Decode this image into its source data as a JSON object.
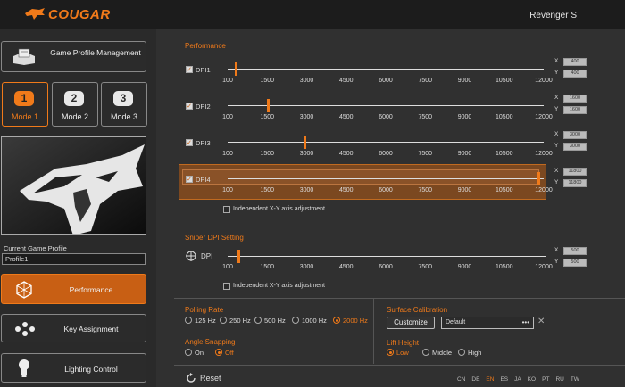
{
  "brand": "COUGAR",
  "device_name": "Revenger S",
  "sidebar": {
    "game_profile_label": "Game Profile Management",
    "modes": [
      {
        "num": "1",
        "label": "Mode 1",
        "selected": true
      },
      {
        "num": "2",
        "label": "Mode 2",
        "selected": false
      },
      {
        "num": "3",
        "label": "Mode 3",
        "selected": false
      }
    ],
    "current_profile_label": "Current Game Profile",
    "current_profile_value": "Profile1",
    "nav": [
      {
        "label": "Performance",
        "icon": "hexagon-icon",
        "selected": true
      },
      {
        "label": "Key Assignment",
        "icon": "mouse-buttons-icon",
        "selected": false
      },
      {
        "label": "Lighting Control",
        "icon": "lightbulb-icon",
        "selected": false
      }
    ]
  },
  "performance": {
    "title": "Performance",
    "ticks": [
      "100",
      "1500",
      "3000",
      "4500",
      "6000",
      "7500",
      "9000",
      "10500",
      "12000"
    ],
    "dpi_levels": [
      {
        "label": "DPI1",
        "checked": true,
        "value": 400,
        "x": "400",
        "y": "400",
        "selected": false
      },
      {
        "label": "DPI2",
        "checked": true,
        "value": 1600,
        "x": "1600",
        "y": "1600",
        "selected": false
      },
      {
        "label": "DPI3",
        "checked": true,
        "value": 3000,
        "x": "3000",
        "y": "3000",
        "selected": false
      },
      {
        "label": "DPI4",
        "checked": true,
        "value": 11800,
        "x": "11800",
        "y": "11800",
        "selected": true
      }
    ],
    "independent_label": "Independent X-Y axis adjustment",
    "x_label": "X",
    "y_label": "Y"
  },
  "sniper": {
    "title": "Sniper DPI Setting",
    "label": "DPI",
    "value": 500,
    "x": "500",
    "y": "500",
    "independent_label": "Independent X-Y axis adjustment"
  },
  "polling": {
    "title": "Polling Rate",
    "options": [
      "125 Hz",
      "250 Hz",
      "500 Hz",
      "1000 Hz",
      "2000 Hz"
    ],
    "selected": "2000 Hz"
  },
  "angle_snapping": {
    "title": "Angle Snapping",
    "options": [
      "On",
      "Off"
    ],
    "selected": "Off"
  },
  "surface": {
    "title": "Surface Calibration",
    "customize_label": "Customize",
    "value": "Default",
    "dots": "•••"
  },
  "lift_height": {
    "title": "Lift Height",
    "options": [
      "Low",
      "Middle",
      "High"
    ],
    "selected": "Low"
  },
  "reset_label": "Reset",
  "languages": [
    "CN",
    "DE",
    "EN",
    "ES",
    "JA",
    "KO",
    "PT",
    "RU",
    "TW"
  ],
  "current_language": "EN",
  "colors": {
    "accent": "#f07a1a",
    "panel": "#303030",
    "sidebar": "#2a2a2a"
  }
}
